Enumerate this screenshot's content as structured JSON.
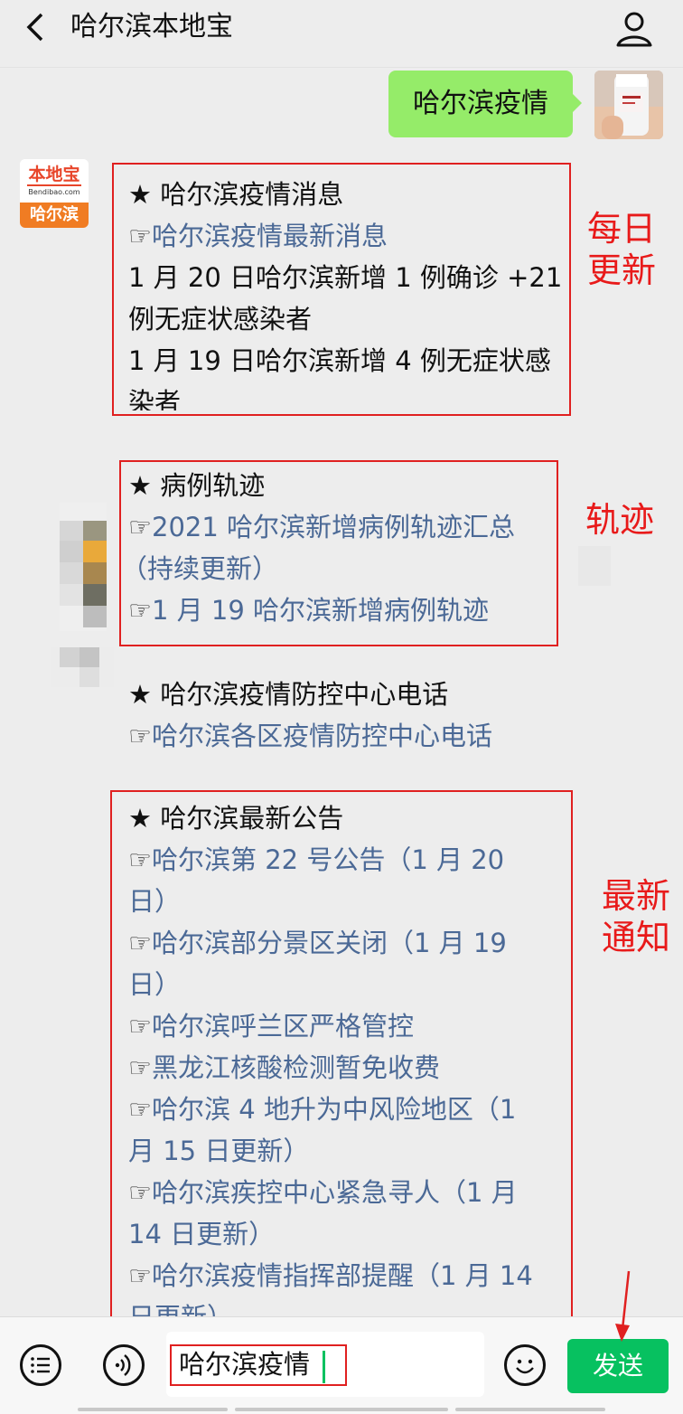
{
  "header": {
    "back_icon": "chevron-left-icon",
    "title": "哈尔滨本地宝",
    "profile_icon": "person-icon"
  },
  "chat": {
    "user_message": "哈尔滨疫情",
    "bot_avatar": {
      "logo_text": "本地宝",
      "logo_sub": "Bendibao.com",
      "city": "哈尔滨"
    },
    "sections": [
      {
        "heading": "★ 哈尔滨疫情消息",
        "lines": [
          {
            "type": "link",
            "text": "哈尔滨疫情最新消息"
          },
          {
            "type": "text",
            "text": "1 月 20 日哈尔滨新增 1 例确诊 +21"
          },
          {
            "type": "text",
            "text": "例无症状感染者"
          },
          {
            "type": "text",
            "text": "1 月 19 日哈尔滨新增 4 例无症状感"
          },
          {
            "type": "text",
            "text": "染者"
          }
        ]
      },
      {
        "heading": "★ 病例轨迹",
        "lines": [
          {
            "type": "link",
            "text": "2021 哈尔滨新增病例轨迹汇总"
          },
          {
            "type": "link-cont",
            "text": "（持续更新）"
          },
          {
            "type": "link",
            "text": "1 月 19 哈尔滨新增病例轨迹"
          }
        ]
      },
      {
        "heading": "★ 哈尔滨疫情防控中心电话",
        "lines": [
          {
            "type": "link",
            "text": "哈尔滨各区疫情防控中心电话"
          }
        ]
      },
      {
        "heading": "★ 哈尔滨最新公告",
        "lines": [
          {
            "type": "link",
            "text": "哈尔滨第 22 号公告（1 月 20"
          },
          {
            "type": "link-cont",
            "text": "日）"
          },
          {
            "type": "link",
            "text": "哈尔滨部分景区关闭（1 月 19"
          },
          {
            "type": "link-cont",
            "text": "日）"
          },
          {
            "type": "link",
            "text": "哈尔滨呼兰区严格管控"
          },
          {
            "type": "link",
            "text": "黑龙江核酸检测暂免收费"
          },
          {
            "type": "link",
            "text": "哈尔滨 4 地升为中风险地区（1"
          },
          {
            "type": "link-cont",
            "text": "月 15 日更新）"
          },
          {
            "type": "link",
            "text": "哈尔滨疾控中心紧急寻人（1 月"
          },
          {
            "type": "link-cont",
            "text": "14 日更新）"
          },
          {
            "type": "link",
            "text": "哈尔滨疫情指挥部提醒（1 月 14"
          },
          {
            "type": "link-cont",
            "text": "日更新）"
          }
        ]
      }
    ],
    "hand_glyph": "☞",
    "annotations": {
      "daily_update": [
        "每日",
        "更新"
      ],
      "track": "轨迹",
      "latest_notice": [
        "最新",
        "通知"
      ]
    }
  },
  "input_bar": {
    "menu_icon": "list-menu-icon",
    "voice_icon": "voice-icon",
    "input_value": "哈尔滨疫情",
    "emoji_icon": "smiley-icon",
    "send_label": "发送"
  },
  "colors": {
    "background": "#ededed",
    "user_bubble": "#95ec69",
    "link": "#4b6996",
    "highlight_red": "#e02020",
    "send_green": "#07c160"
  }
}
